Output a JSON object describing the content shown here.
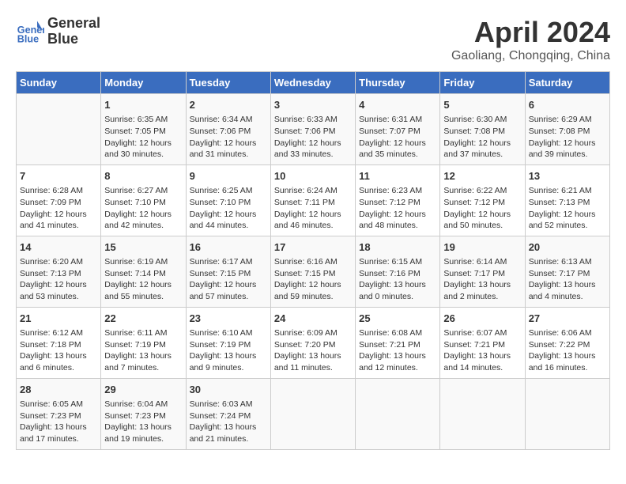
{
  "header": {
    "logo_line1": "General",
    "logo_line2": "Blue",
    "month": "April 2024",
    "location": "Gaoliang, Chongqing, China"
  },
  "days_of_week": [
    "Sunday",
    "Monday",
    "Tuesday",
    "Wednesday",
    "Thursday",
    "Friday",
    "Saturday"
  ],
  "weeks": [
    [
      {
        "day": "",
        "content": ""
      },
      {
        "day": "1",
        "content": "Sunrise: 6:35 AM\nSunset: 7:05 PM\nDaylight: 12 hours\nand 30 minutes."
      },
      {
        "day": "2",
        "content": "Sunrise: 6:34 AM\nSunset: 7:06 PM\nDaylight: 12 hours\nand 31 minutes."
      },
      {
        "day": "3",
        "content": "Sunrise: 6:33 AM\nSunset: 7:06 PM\nDaylight: 12 hours\nand 33 minutes."
      },
      {
        "day": "4",
        "content": "Sunrise: 6:31 AM\nSunset: 7:07 PM\nDaylight: 12 hours\nand 35 minutes."
      },
      {
        "day": "5",
        "content": "Sunrise: 6:30 AM\nSunset: 7:08 PM\nDaylight: 12 hours\nand 37 minutes."
      },
      {
        "day": "6",
        "content": "Sunrise: 6:29 AM\nSunset: 7:08 PM\nDaylight: 12 hours\nand 39 minutes."
      }
    ],
    [
      {
        "day": "7",
        "content": "Sunrise: 6:28 AM\nSunset: 7:09 PM\nDaylight: 12 hours\nand 41 minutes."
      },
      {
        "day": "8",
        "content": "Sunrise: 6:27 AM\nSunset: 7:10 PM\nDaylight: 12 hours\nand 42 minutes."
      },
      {
        "day": "9",
        "content": "Sunrise: 6:25 AM\nSunset: 7:10 PM\nDaylight: 12 hours\nand 44 minutes."
      },
      {
        "day": "10",
        "content": "Sunrise: 6:24 AM\nSunset: 7:11 PM\nDaylight: 12 hours\nand 46 minutes."
      },
      {
        "day": "11",
        "content": "Sunrise: 6:23 AM\nSunset: 7:12 PM\nDaylight: 12 hours\nand 48 minutes."
      },
      {
        "day": "12",
        "content": "Sunrise: 6:22 AM\nSunset: 7:12 PM\nDaylight: 12 hours\nand 50 minutes."
      },
      {
        "day": "13",
        "content": "Sunrise: 6:21 AM\nSunset: 7:13 PM\nDaylight: 12 hours\nand 52 minutes."
      }
    ],
    [
      {
        "day": "14",
        "content": "Sunrise: 6:20 AM\nSunset: 7:13 PM\nDaylight: 12 hours\nand 53 minutes."
      },
      {
        "day": "15",
        "content": "Sunrise: 6:19 AM\nSunset: 7:14 PM\nDaylight: 12 hours\nand 55 minutes."
      },
      {
        "day": "16",
        "content": "Sunrise: 6:17 AM\nSunset: 7:15 PM\nDaylight: 12 hours\nand 57 minutes."
      },
      {
        "day": "17",
        "content": "Sunrise: 6:16 AM\nSunset: 7:15 PM\nDaylight: 12 hours\nand 59 minutes."
      },
      {
        "day": "18",
        "content": "Sunrise: 6:15 AM\nSunset: 7:16 PM\nDaylight: 13 hours\nand 0 minutes."
      },
      {
        "day": "19",
        "content": "Sunrise: 6:14 AM\nSunset: 7:17 PM\nDaylight: 13 hours\nand 2 minutes."
      },
      {
        "day": "20",
        "content": "Sunrise: 6:13 AM\nSunset: 7:17 PM\nDaylight: 13 hours\nand 4 minutes."
      }
    ],
    [
      {
        "day": "21",
        "content": "Sunrise: 6:12 AM\nSunset: 7:18 PM\nDaylight: 13 hours\nand 6 minutes."
      },
      {
        "day": "22",
        "content": "Sunrise: 6:11 AM\nSunset: 7:19 PM\nDaylight: 13 hours\nand 7 minutes."
      },
      {
        "day": "23",
        "content": "Sunrise: 6:10 AM\nSunset: 7:19 PM\nDaylight: 13 hours\nand 9 minutes."
      },
      {
        "day": "24",
        "content": "Sunrise: 6:09 AM\nSunset: 7:20 PM\nDaylight: 13 hours\nand 11 minutes."
      },
      {
        "day": "25",
        "content": "Sunrise: 6:08 AM\nSunset: 7:21 PM\nDaylight: 13 hours\nand 12 minutes."
      },
      {
        "day": "26",
        "content": "Sunrise: 6:07 AM\nSunset: 7:21 PM\nDaylight: 13 hours\nand 14 minutes."
      },
      {
        "day": "27",
        "content": "Sunrise: 6:06 AM\nSunset: 7:22 PM\nDaylight: 13 hours\nand 16 minutes."
      }
    ],
    [
      {
        "day": "28",
        "content": "Sunrise: 6:05 AM\nSunset: 7:23 PM\nDaylight: 13 hours\nand 17 minutes."
      },
      {
        "day": "29",
        "content": "Sunrise: 6:04 AM\nSunset: 7:23 PM\nDaylight: 13 hours\nand 19 minutes."
      },
      {
        "day": "30",
        "content": "Sunrise: 6:03 AM\nSunset: 7:24 PM\nDaylight: 13 hours\nand 21 minutes."
      },
      {
        "day": "",
        "content": ""
      },
      {
        "day": "",
        "content": ""
      },
      {
        "day": "",
        "content": ""
      },
      {
        "day": "",
        "content": ""
      }
    ]
  ]
}
